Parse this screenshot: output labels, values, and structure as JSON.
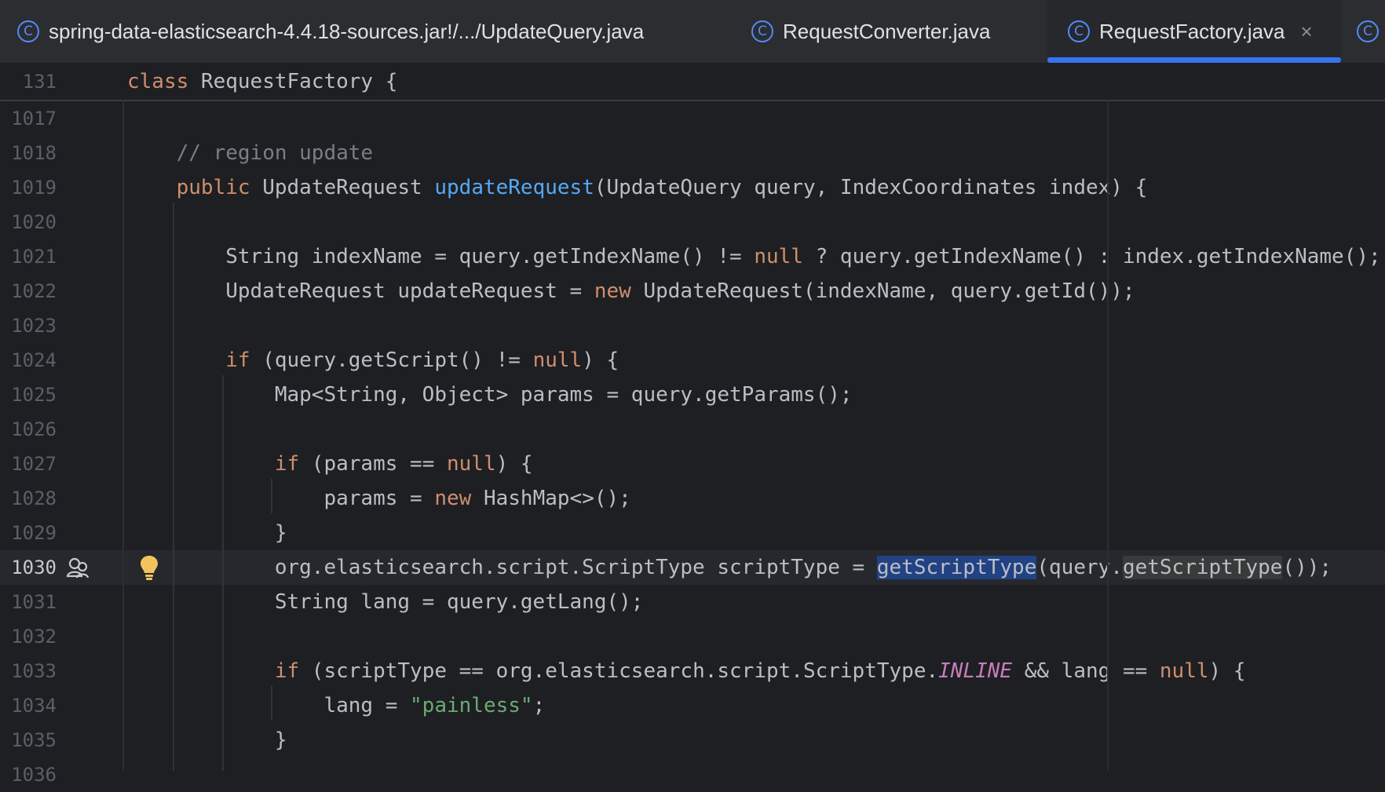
{
  "tabs": [
    {
      "label": "spring-data-elasticsearch-4.4.18-sources.jar!/.../UpdateQuery.java",
      "icon": "class-icon",
      "active": false
    },
    {
      "label": "RequestConverter.java",
      "icon": "class-icon",
      "active": false
    },
    {
      "label": "RequestFactory.java",
      "icon": "class-icon",
      "active": true,
      "close": "×"
    }
  ],
  "icon_glyph": "C",
  "sticky": {
    "line": "131",
    "code": "class RequestFactory {"
  },
  "editor": {
    "lines": [
      {
        "n": "1017",
        "code": ""
      },
      {
        "n": "1018",
        "code": "    // region update"
      },
      {
        "n": "1019",
        "code": "    public UpdateRequest updateRequest(UpdateQuery query, IndexCoordinates index) {"
      },
      {
        "n": "1020",
        "code": ""
      },
      {
        "n": "1021",
        "code": "        String indexName = query.getIndexName() != null ? query.getIndexName() : index.getIndexName();"
      },
      {
        "n": "1022",
        "code": "        UpdateRequest updateRequest = new UpdateRequest(indexName, query.getId());"
      },
      {
        "n": "1023",
        "code": ""
      },
      {
        "n": "1024",
        "code": "        if (query.getScript() != null) {"
      },
      {
        "n": "1025",
        "code": "            Map<String, Object> params = query.getParams();"
      },
      {
        "n": "1026",
        "code": ""
      },
      {
        "n": "1027",
        "code": "            if (params == null) {"
      },
      {
        "n": "1028",
        "code": "                params = new HashMap<>();"
      },
      {
        "n": "1029",
        "code": "            }"
      },
      {
        "n": "1030",
        "code": "            org.elasticsearch.script.ScriptType scriptType = getScriptType(query.getScriptType());"
      },
      {
        "n": "1031",
        "code": "            String lang = query.getLang();"
      },
      {
        "n": "1032",
        "code": ""
      },
      {
        "n": "1033",
        "code": "            if (scriptType == org.elasticsearch.script.ScriptType.INLINE && lang == null) {"
      },
      {
        "n": "1034",
        "code": "                lang = \"painless\";"
      },
      {
        "n": "1035",
        "code": "            }"
      },
      {
        "n": "1036",
        "code": ""
      }
    ],
    "current_line": "1030"
  },
  "colors": {
    "accent": "#3574f0",
    "keyword": "#cf8e6d",
    "function": "#56a8f5",
    "string": "#6aab73",
    "constant": "#c77dbb"
  }
}
